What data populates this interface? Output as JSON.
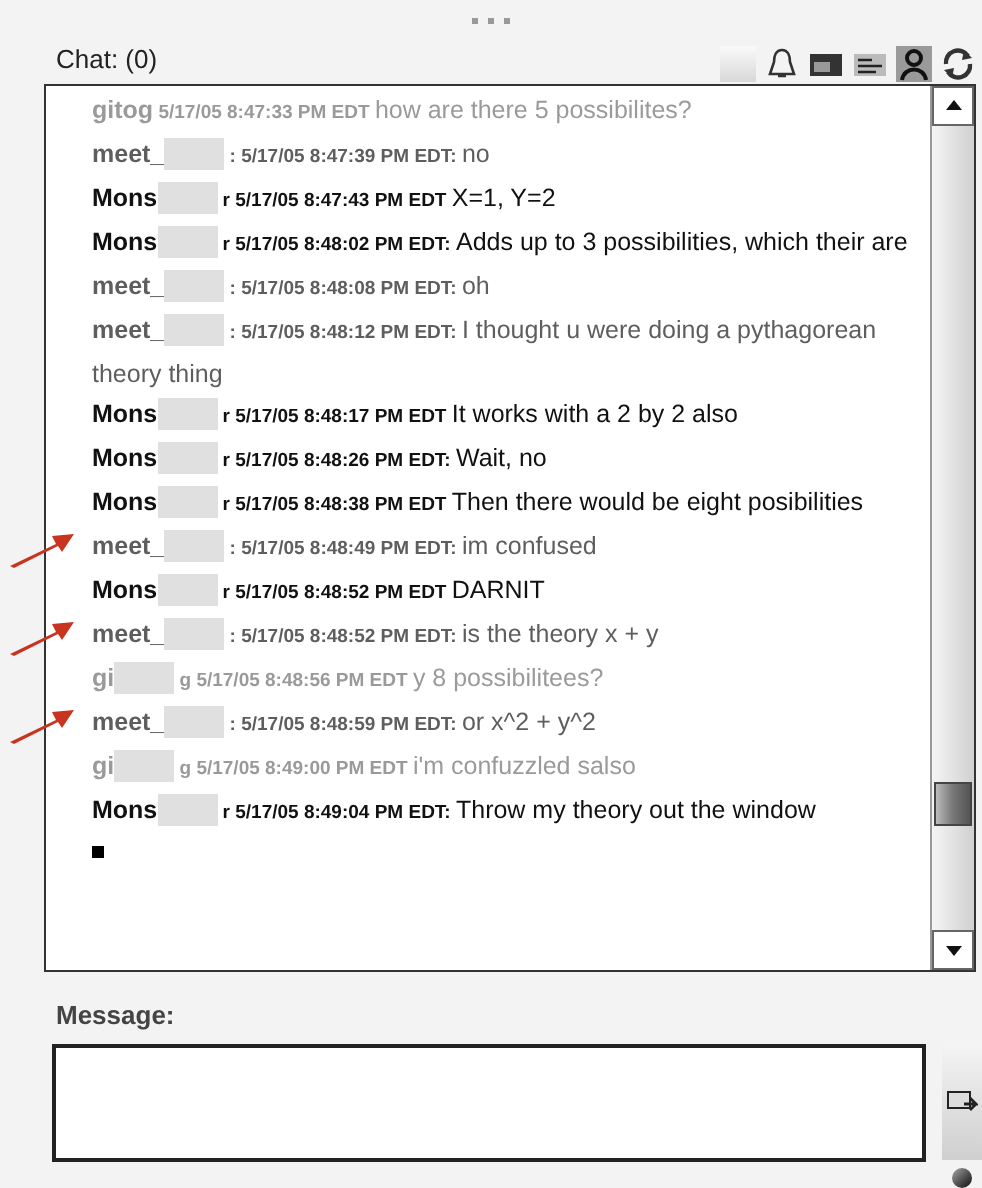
{
  "chat": {
    "title": "Chat: (0)"
  },
  "messages": [
    {
      "name": "gitog",
      "redacted": false,
      "meta": "5/17/05 8:47:33 PM EDT",
      "text": "how are there 5 possibilites?",
      "color": "#9a9a9a",
      "marked": false
    },
    {
      "name": "meet_",
      "redacted": true,
      "meta": ": 5/17/05 8:47:39 PM EDT:",
      "text": "no",
      "color": "#5e5e5e",
      "marked": false
    },
    {
      "name": "Mons",
      "redacted": true,
      "meta": "r 5/17/05 8:47:43 PM EDT",
      "text": "X=1, Y=2",
      "color": "#111111",
      "marked": false
    },
    {
      "name": "Mons",
      "redacted": true,
      "meta": "r 5/17/05 8:48:02 PM EDT:",
      "text": "Adds up to 3 possibilities, which their are",
      "color": "#111111",
      "marked": false
    },
    {
      "name": "meet_",
      "redacted": true,
      "meta": ": 5/17/05 8:48:08 PM EDT:",
      "text": "oh",
      "color": "#5e5e5e",
      "marked": false
    },
    {
      "name": "meet_",
      "redacted": true,
      "meta": ": 5/17/05 8:48:12 PM EDT:",
      "text": "I thought u were doing a pythagorean theory thing",
      "color": "#5e5e5e",
      "marked": false
    },
    {
      "name": "Mons",
      "redacted": true,
      "meta": "r 5/17/05 8:48:17 PM EDT",
      "text": "It works with a 2 by 2 also",
      "color": "#111111",
      "marked": false
    },
    {
      "name": "Mons",
      "redacted": true,
      "meta": "r 5/17/05 8:48:26 PM EDT:",
      "text": "Wait, no",
      "color": "#111111",
      "marked": false
    },
    {
      "name": "Mons",
      "redacted": true,
      "meta": "r 5/17/05 8:48:38 PM EDT",
      "text": "Then there would be eight posibilities",
      "color": "#111111",
      "marked": false
    },
    {
      "name": "meet_",
      "redacted": true,
      "meta": ": 5/17/05 8:48:49 PM EDT:",
      "text": "im confused",
      "color": "#5e5e5e",
      "marked": true
    },
    {
      "name": "Mons",
      "redacted": true,
      "meta": "r 5/17/05 8:48:52 PM EDT",
      "text": "DARNIT",
      "color": "#111111",
      "marked": false
    },
    {
      "name": "meet_",
      "redacted": true,
      "meta": ": 5/17/05 8:48:52 PM EDT:",
      "text": "is the theory x + y",
      "color": "#5e5e5e",
      "marked": true
    },
    {
      "name": "gi",
      "redacted": true,
      "meta": "g 5/17/05 8:48:56 PM EDT",
      "text": "y  8 possibilitees?",
      "color": "#9a9a9a",
      "marked": false
    },
    {
      "name": "meet_",
      "redacted": true,
      "meta": ": 5/17/05 8:48:59 PM EDT:",
      "text": "or x^2 + y^2",
      "color": "#5e5e5e",
      "marked": true
    },
    {
      "name": "gi",
      "redacted": true,
      "meta": "g 5/17/05 8:49:00 PM EDT",
      "text": "i'm confuzzled salso",
      "color": "#9a9a9a",
      "marked": false
    },
    {
      "name": "Mons",
      "redacted": true,
      "meta": "r 5/17/05 8:49:04 PM EDT:",
      "text": "Throw my theory out the window",
      "color": "#111111",
      "marked": false
    }
  ],
  "message": {
    "label": "Message:"
  }
}
